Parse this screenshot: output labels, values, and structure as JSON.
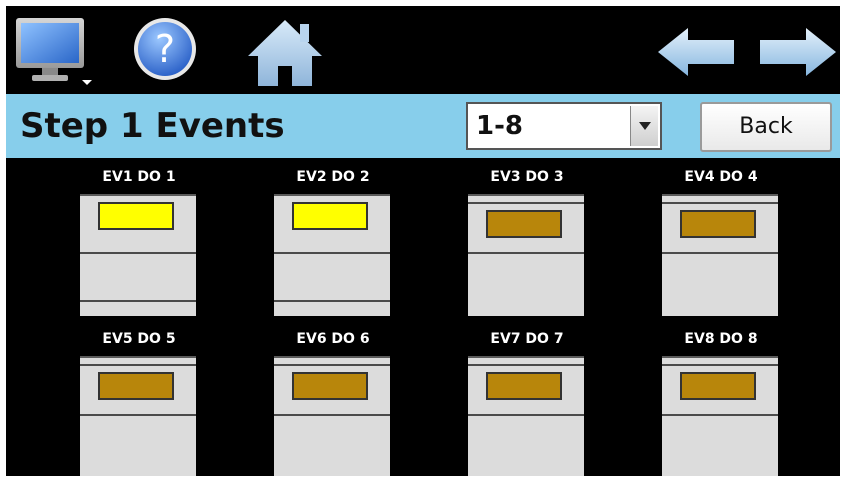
{
  "toolbar": {
    "icons": [
      "monitor-icon",
      "help-icon",
      "home-icon",
      "arrow-left-icon",
      "arrow-right-icon"
    ]
  },
  "header": {
    "title": "Step 1 Events",
    "range_select": {
      "value": "1-8"
    },
    "back_label": "Back"
  },
  "events": [
    {
      "label": "EV1 DO 1",
      "state": "on"
    },
    {
      "label": "EV2 DO 2",
      "state": "on"
    },
    {
      "label": "EV3 DO 3",
      "state": "off"
    },
    {
      "label": "EV4 DO 4",
      "state": "off"
    },
    {
      "label": "EV5 DO 5",
      "state": "off"
    },
    {
      "label": "EV6 DO 6",
      "state": "off"
    },
    {
      "label": "EV7 DO 7",
      "state": "off"
    },
    {
      "label": "EV8 DO 8",
      "state": "off"
    }
  ],
  "colors": {
    "screen_bg": "#000000",
    "header_bg": "#87ceeb",
    "led_on": "#ffff00",
    "led_off": "#b8860b",
    "event_box": "#dcdcdc"
  }
}
